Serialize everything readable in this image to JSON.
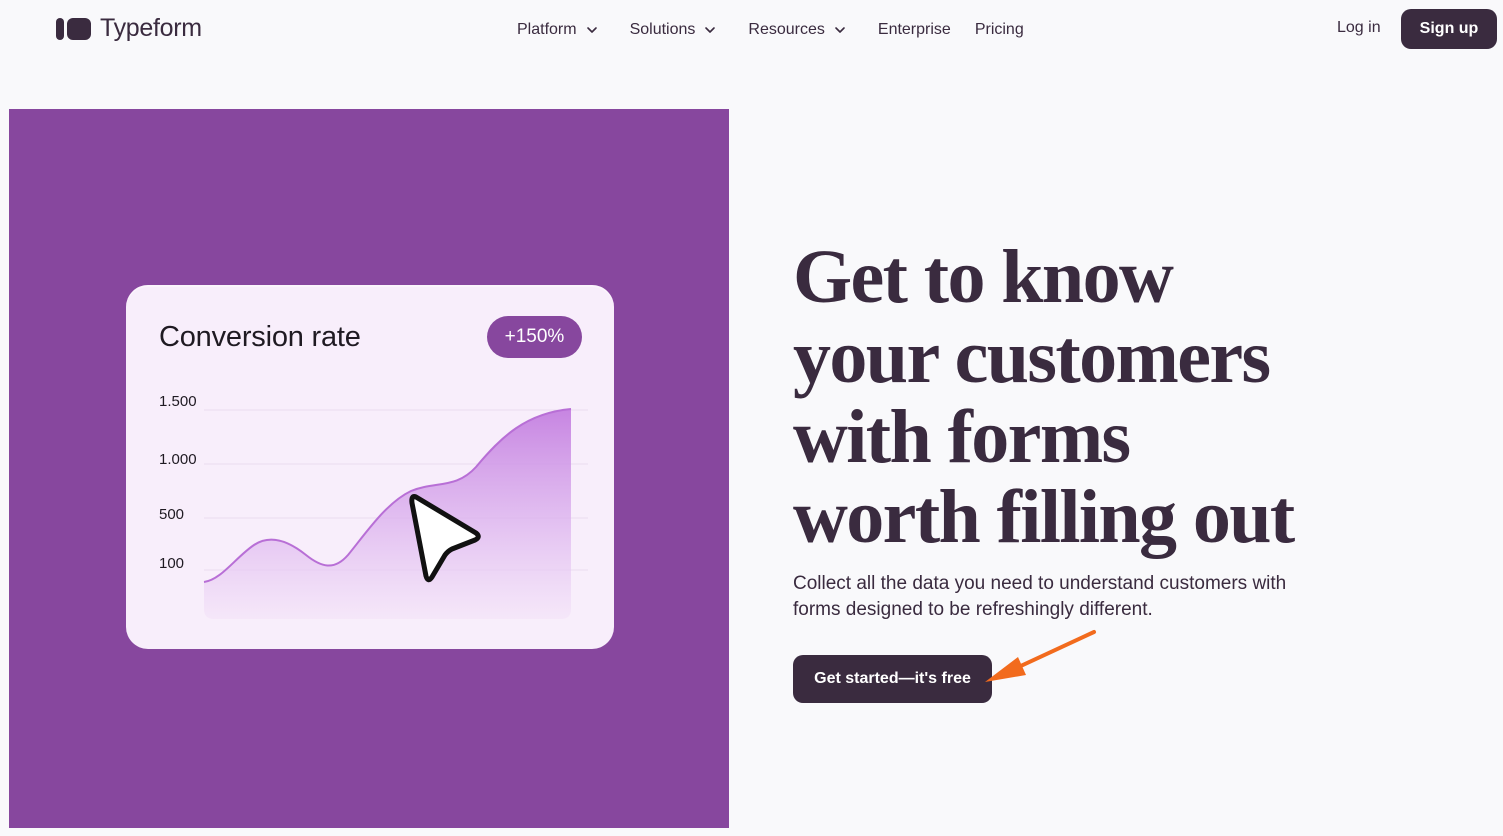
{
  "header": {
    "logo_text": "Typeform",
    "nav": [
      {
        "label": "Platform",
        "has_dropdown": true
      },
      {
        "label": "Solutions",
        "has_dropdown": true
      },
      {
        "label": "Resources",
        "has_dropdown": true
      },
      {
        "label": "Enterprise",
        "has_dropdown": false
      },
      {
        "label": "Pricing",
        "has_dropdown": false
      }
    ],
    "login_label": "Log in",
    "signup_label": "Sign up"
  },
  "hero": {
    "headline_lines": [
      "Get to know",
      "your customers",
      "with forms",
      "worth filling out"
    ],
    "subhead_lines": [
      "Collect all the data you need to understand customers with",
      "forms designed to be refreshingly different."
    ],
    "cta_label": "Get started—it's free"
  },
  "illustration": {
    "card_title": "Conversion rate",
    "badge": "+150%",
    "y_ticks": [
      "1.500",
      "1.000",
      "500",
      "100"
    ],
    "icon": "cursor-arrow-icon"
  },
  "annotation": {
    "icon": "orange-arrow-icon",
    "color": "#f26b1d"
  },
  "colors": {
    "brand_dark": "#3a2b3f",
    "hero_purple": "#87479e",
    "card_bg": "#f8eefb",
    "page_bg": "#f9f9fb"
  }
}
